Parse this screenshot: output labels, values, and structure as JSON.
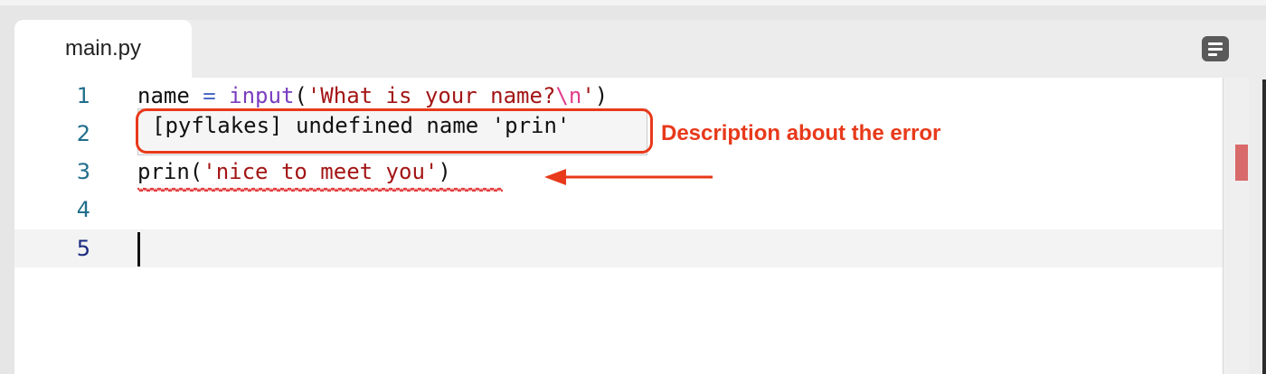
{
  "tab": {
    "filename": "main.py"
  },
  "toolbar": {
    "menu_icon": "menu-lines-icon"
  },
  "editor": {
    "lines": [
      {
        "number": "1",
        "tokens": [
          {
            "text": "name ",
            "cls": ""
          },
          {
            "text": "=",
            "cls": "op"
          },
          {
            "text": " ",
            "cls": ""
          },
          {
            "text": "input",
            "cls": "fn"
          },
          {
            "text": "(",
            "cls": ""
          },
          {
            "text": "'What is your name?",
            "cls": "str"
          },
          {
            "text": "\\n",
            "cls": "esc"
          },
          {
            "text": "'",
            "cls": "str"
          },
          {
            "text": ")",
            "cls": ""
          }
        ]
      },
      {
        "number": "2",
        "tokens": []
      },
      {
        "number": "3",
        "tokens": [
          {
            "text": "prin",
            "cls": ""
          },
          {
            "text": "(",
            "cls": ""
          },
          {
            "text": "'nice to meet you'",
            "cls": "str"
          },
          {
            "text": ")",
            "cls": ""
          }
        ]
      },
      {
        "number": "4",
        "tokens": []
      },
      {
        "number": "5",
        "tokens": []
      }
    ],
    "active_line": "5",
    "error_tooltip": "[pyflakes] undefined name 'prin'"
  },
  "annotation": {
    "text": "Description about the error",
    "color": "#e8391a"
  },
  "colors": {
    "error": "#e03030",
    "line_number": "#1f6e8c",
    "string": "#a31515",
    "keyword_fn": "#7a3dbf"
  }
}
